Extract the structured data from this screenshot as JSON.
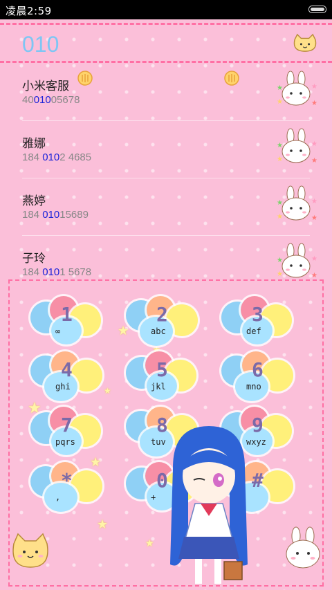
{
  "status_bar": {
    "time": "凌晨2:59"
  },
  "dialer": {
    "input_number": "010"
  },
  "contacts": [
    {
      "name": "小米客服",
      "number_pre": "40",
      "number_match": "010",
      "number_post": "05678"
    },
    {
      "name": "雅娜",
      "number_pre": "184 ",
      "number_match": "010",
      "number_post": "2 4685"
    },
    {
      "name": "燕婷",
      "number_pre": "184 ",
      "number_match": "010",
      "number_post": "15689"
    },
    {
      "name": "子玲",
      "number_pre": "184 ",
      "number_match": "010",
      "number_post": "1 5678"
    }
  ],
  "keypad": [
    {
      "digit": "1",
      "letters": "∞"
    },
    {
      "digit": "2",
      "letters": "abc"
    },
    {
      "digit": "3",
      "letters": "def"
    },
    {
      "digit": "4",
      "letters": "ghi"
    },
    {
      "digit": "5",
      "letters": "jkl"
    },
    {
      "digit": "6",
      "letters": "mno"
    },
    {
      "digit": "7",
      "letters": "pqrs"
    },
    {
      "digit": "8",
      "letters": "tuv"
    },
    {
      "digit": "9",
      "letters": "wxyz"
    },
    {
      "digit": "*",
      "letters": ","
    },
    {
      "digit": "0",
      "letters": "+"
    },
    {
      "digit": "#",
      "letters": ""
    }
  ],
  "colors": {
    "accent_pink": "#ff6fa4",
    "match_blue": "#1d24d9",
    "display_blue": "#7ec6f4",
    "background": "#fbbfd9"
  },
  "icons": [
    "cat-icon",
    "bunny-icon",
    "coin-badge-icon",
    "anime-girl-icon",
    "star-icon",
    "battery-icon"
  ]
}
